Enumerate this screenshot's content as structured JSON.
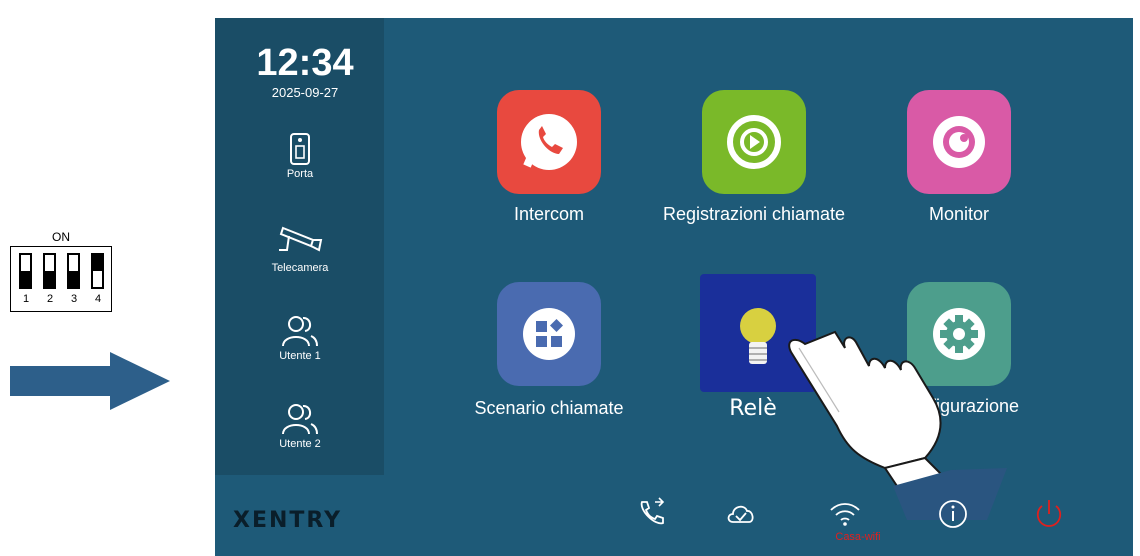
{
  "dip_switch": {
    "on_label": "ON",
    "switches": [
      {
        "number": "1",
        "state": "off"
      },
      {
        "number": "2",
        "state": "off"
      },
      {
        "number": "3",
        "state": "off"
      },
      {
        "number": "4",
        "state": "on"
      }
    ]
  },
  "status": {
    "time": "12:34",
    "date": "2025-09-27"
  },
  "sidebar": {
    "items": [
      {
        "label": "Porta",
        "icon": "door-icon"
      },
      {
        "label": "Telecamera",
        "icon": "camera-icon"
      },
      {
        "label": "Utente 1",
        "icon": "users-icon"
      },
      {
        "label": "Utente 2",
        "icon": "users-icon"
      }
    ]
  },
  "apps": [
    {
      "label": "Intercom",
      "icon": "phone-icon",
      "color": "#e8493f"
    },
    {
      "label": "Registrazioni chiamate",
      "icon": "play-record-icon",
      "color": "#7ab929"
    },
    {
      "label": "Monitor",
      "icon": "eye-icon",
      "color": "#d95aa6"
    },
    {
      "label": "Scenario chiamate",
      "icon": "grid-icon",
      "color": "#4a6bb0"
    },
    {
      "label": "Relè",
      "icon": "bulb-icon",
      "color": "#1a2f9a"
    },
    {
      "label": "figurazione",
      "icon": "gear-icon",
      "color": "#4d9e8c"
    }
  ],
  "bottom_bar": {
    "brand": "XENTRY",
    "wifi_name": "Casa-wifi",
    "icons": [
      "call-forward-icon",
      "cloud-check-icon",
      "wifi-icon",
      "info-icon",
      "power-icon"
    ],
    "power_color": "#e0201e"
  }
}
